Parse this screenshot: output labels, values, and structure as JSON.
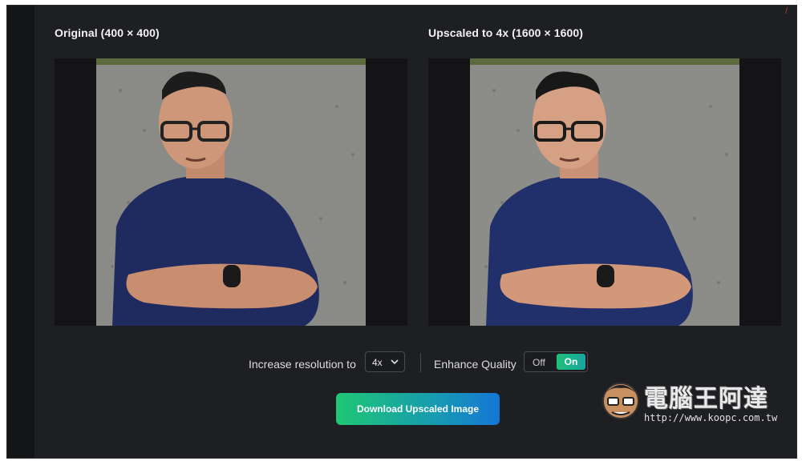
{
  "left_panel": {
    "title": "Original (400 × 400)"
  },
  "right_panel": {
    "title": "Upscaled to 4x (1600 × 1600)"
  },
  "controls": {
    "resolution_label": "Increase resolution to",
    "resolution_value": "4x",
    "enhance_label": "Enhance Quality",
    "toggle_off": "Off",
    "toggle_on": "On",
    "enhance_state": "On"
  },
  "download_label": "Download Upscaled Image",
  "watermark": {
    "text": "電腦王阿達",
    "url": "http://www.koopc.com.tw"
  },
  "colors": {
    "accent_start": "#1ec774",
    "accent_end": "#1576d6",
    "background": "#1e1f22"
  },
  "icons": {
    "chevron": "chevron-down-icon"
  }
}
